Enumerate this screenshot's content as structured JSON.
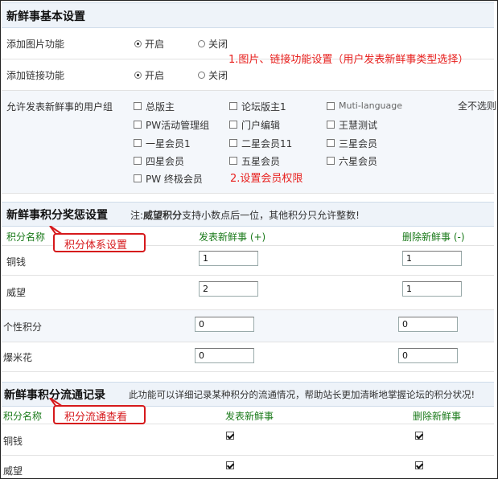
{
  "basic": {
    "title": "新鲜事基本设置",
    "image_label": "添加图片功能",
    "link_label": "添加链接功能",
    "on": "开启",
    "off": "关闭",
    "note1": "1.图片、链接功能设置（用户发表新鲜事类型选择）",
    "groups_label": "允许发表新鲜事的用户组",
    "deselect_all": "全不选则",
    "groups": [
      "总版主",
      "论坛版主1",
      "Muti-language",
      "PW活动管理组",
      "门户编辑",
      "王慧测试",
      "一星会员1",
      "二星会员11",
      "三星会员",
      "四星会员",
      "五星会员",
      "六星会员",
      "PW 终极会员"
    ],
    "note2": "2.设置会员权限"
  },
  "reward": {
    "title": "新鲜事积分奖惩设置",
    "note_prefix": "注:",
    "note_bold": "威望积分",
    "note_rest": "支持小数点后一位，其他积分只允许整数!",
    "col_name": "积分名称",
    "col_post": "发表新鲜事 (+)",
    "col_delete": "删除新鲜事 (-)",
    "callout": "积分体系设置",
    "rows": [
      {
        "name": "铜钱",
        "post": "1",
        "delete": "1"
      },
      {
        "name": "威望",
        "post": "2",
        "delete": "1"
      },
      {
        "name": "个性积分",
        "post": "0",
        "delete": "0"
      },
      {
        "name": "爆米花",
        "post": "0",
        "delete": "0"
      }
    ]
  },
  "flow": {
    "title": "新鲜事积分流通记录",
    "desc": "此功能可以详细记录某种积分的流通情况，帮助站长更加清晰地掌握论坛的积分状况!",
    "col_name": "积分名称",
    "col_post": "发表新鲜事",
    "col_delete": "删除新鲜事",
    "callout": "积分流通查看",
    "rows": [
      {
        "name": "铜钱"
      },
      {
        "name": "威望"
      }
    ]
  }
}
